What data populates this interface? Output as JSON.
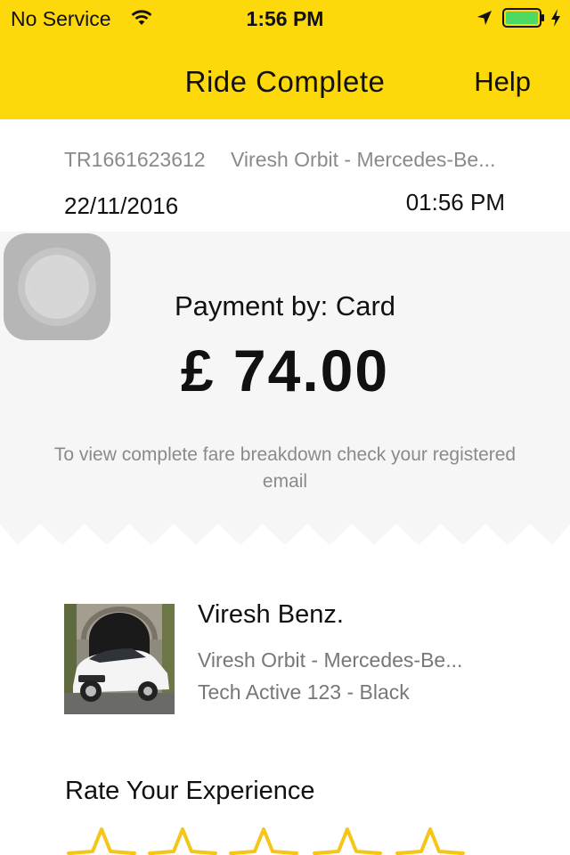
{
  "status_bar": {
    "carrier": "No Service",
    "time": "1:56 PM",
    "battery_color": "#4cd964"
  },
  "nav": {
    "title": "Ride Complete",
    "help_label": "Help",
    "background_color": "#fdd80b"
  },
  "trip": {
    "id": "TR1661623612",
    "vehicle": "Viresh Orbit - Mercedes-Be...",
    "date": "22/11/2016",
    "time": "01:56 PM"
  },
  "payment": {
    "method": "Payment by: Card",
    "amount": "£ 74.00",
    "fare_note": "To view complete fare breakdown check your registered email"
  },
  "driver": {
    "name": "Viresh Benz.",
    "vehicle": "Viresh Orbit - Mercedes-Be...",
    "plate": "Tech Active 123 - Black"
  },
  "rating": {
    "title": "Rate Your Experience",
    "max_stars": 5,
    "star_color": "#f5c518"
  }
}
